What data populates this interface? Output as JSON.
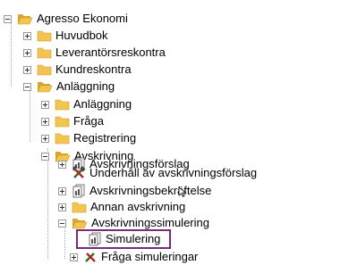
{
  "tree": {
    "root": "Agresso Ekonomi",
    "huvudbok": "Huvudbok",
    "leverantor": "Leverantörsreskontra",
    "kund": "Kundreskontra",
    "anlaggning": "Anläggning",
    "anlaggning_child": "Anläggning",
    "fraga": "Fråga",
    "registrering": "Registrering",
    "avskrivning": "Avskrivning",
    "avskrivningsforslag": "Avskrivningsförslag",
    "underhall": "Underhåll av avskrivningsförslag",
    "bekraftelse": "Avskrivningsbekräftelse",
    "annan": "Annan avskrivning",
    "simulering_folder": "Avskrivningssimulering",
    "simulering": "Simulering",
    "fraga_simuleringar": "Fråga simuleringar"
  },
  "colors": {
    "highlight": "#7b2a78",
    "folder": "#f3c44f",
    "folder_dark": "#d9a52b"
  }
}
